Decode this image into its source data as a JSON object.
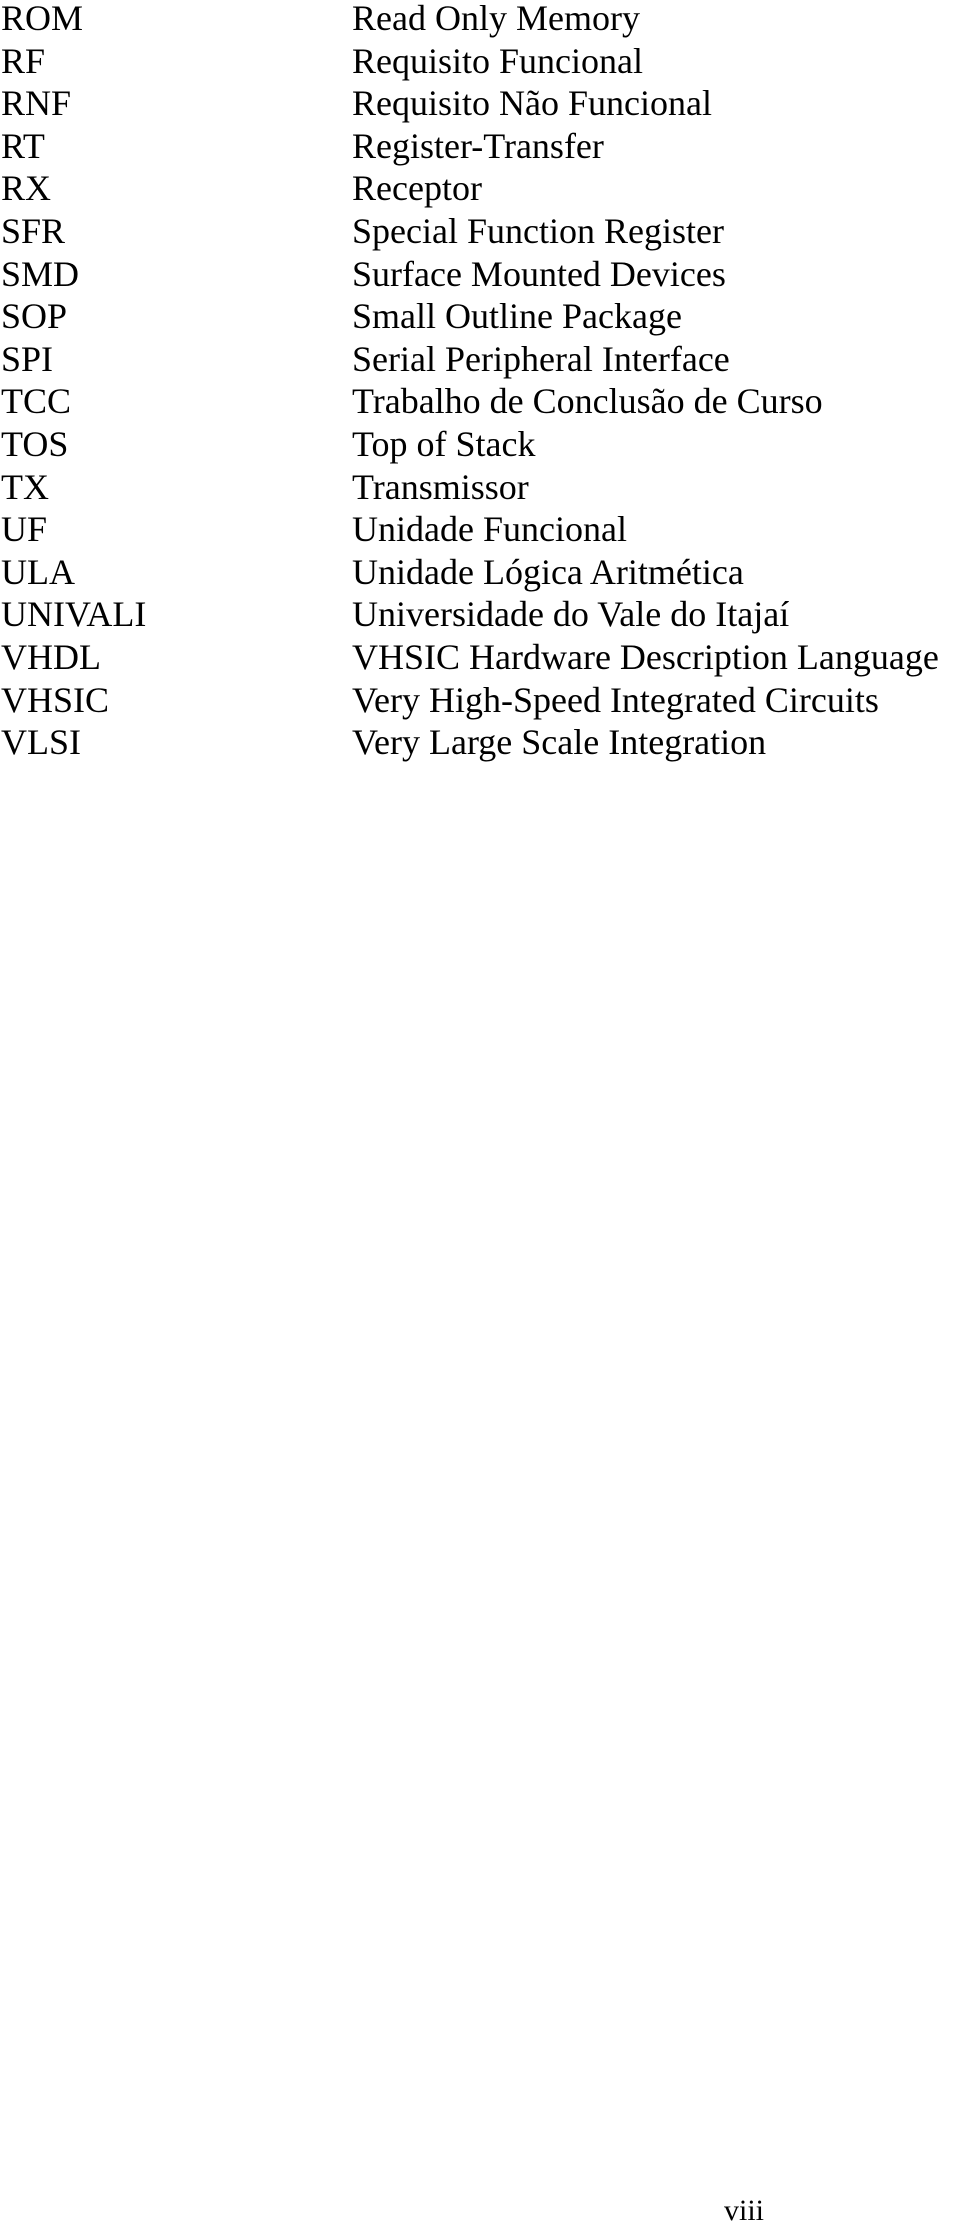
{
  "abbreviations": [
    {
      "term": "ROM",
      "definition": "Read Only Memory"
    },
    {
      "term": "RF",
      "definition": "Requisito Funcional"
    },
    {
      "term": "RNF",
      "definition": "Requisito Não Funcional"
    },
    {
      "term": "RT",
      "definition": "Register-Transfer"
    },
    {
      "term": "RX",
      "definition": "Receptor"
    },
    {
      "term": "SFR",
      "definition": "Special Function Register"
    },
    {
      "term": "SMD",
      "definition": "Surface Mounted Devices"
    },
    {
      "term": "SOP",
      "definition": "Small Outline Package"
    },
    {
      "term": "SPI",
      "definition": "Serial Peripheral Interface"
    },
    {
      "term": "TCC",
      "definition": "Trabalho de Conclusão de Curso"
    },
    {
      "term": "TOS",
      "definition": "Top of Stack"
    },
    {
      "term": "TX",
      "definition": "Transmissor"
    },
    {
      "term": "UF",
      "definition": "Unidade Funcional"
    },
    {
      "term": "ULA",
      "definition": "Unidade Lógica Aritmética"
    },
    {
      "term": "UNIVALI",
      "definition": "Universidade do Vale do Itajaí"
    },
    {
      "term": "VHDL",
      "definition": "VHSIC Hardware Description Language"
    },
    {
      "term": "VHSIC",
      "definition": "Very High-Speed Integrated Circuits"
    },
    {
      "term": "VLSI",
      "definition": "Very Large Scale Integration"
    }
  ],
  "page_number": "viii"
}
